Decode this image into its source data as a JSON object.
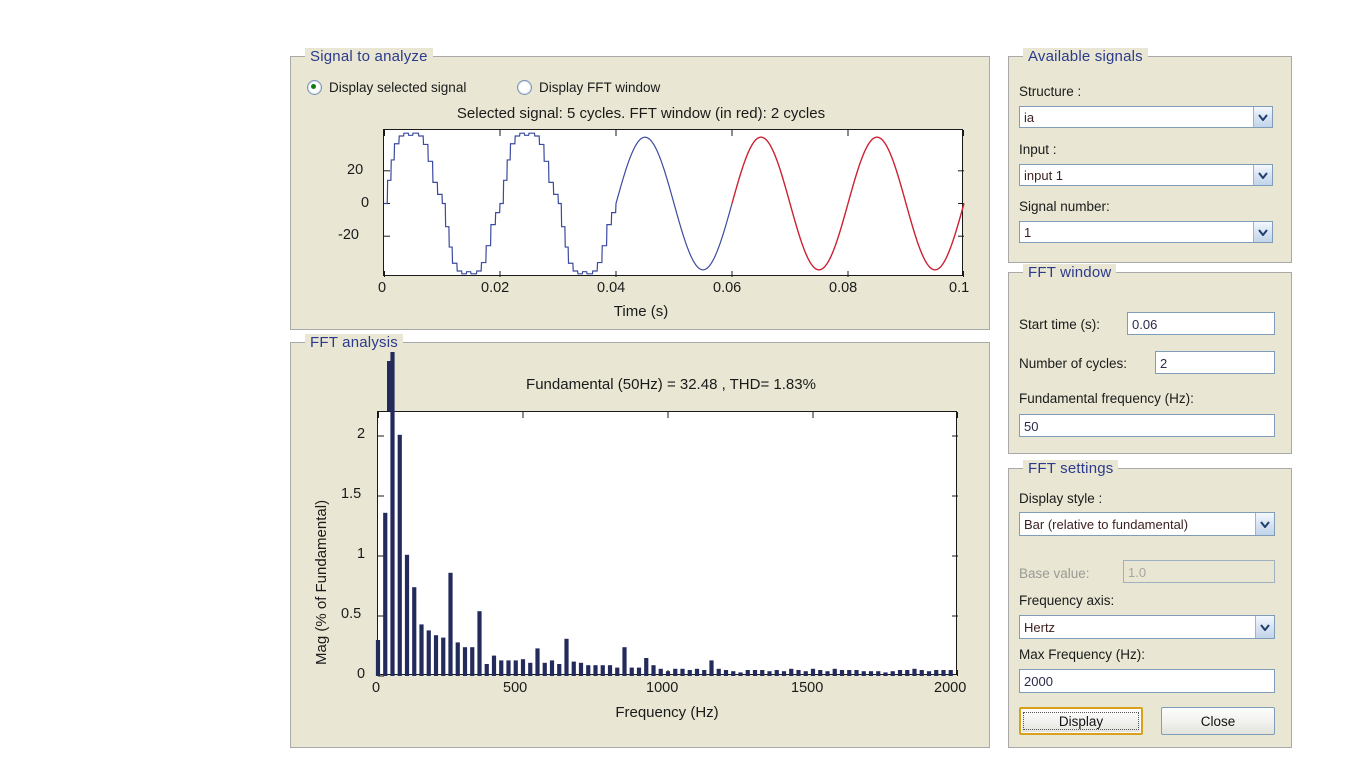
{
  "signal_panel": {
    "title": "Signal to analyze",
    "radios": [
      {
        "label": "Display selected signal",
        "checked": true
      },
      {
        "label": "Display FFT window",
        "checked": false
      }
    ]
  },
  "fft_analysis_panel": {
    "title": "FFT analysis"
  },
  "available_signals": {
    "title": "Available signals",
    "structure_label": "Structure :",
    "structure_value": "ia",
    "input_label": "Input :",
    "input_value": "input 1",
    "signal_number_label": "Signal number:",
    "signal_number_value": "1"
  },
  "fft_window": {
    "title": "FFT window",
    "start_time_label": "Start time (s):",
    "start_time_value": "0.06",
    "cycles_label": "Number of cycles:",
    "cycles_value": "2",
    "fundamental_label": "Fundamental frequency (Hz):",
    "fundamental_value": "50"
  },
  "fft_settings": {
    "title": "FFT settings",
    "display_style_label": "Display style :",
    "display_style_value": "Bar (relative to fundamental)",
    "base_value_label": "Base value:",
    "base_value_value": "1.0",
    "frequency_axis_label": "Frequency axis:",
    "frequency_axis_value": "Hertz",
    "max_frequency_label": "Max Frequency (Hz):",
    "max_frequency_value": "2000",
    "display_button": "Display",
    "close_button": "Close"
  },
  "colors": {
    "panel_bg": "#e9e7d3",
    "panel_title": "#2b3a8c",
    "signal_blue": "#3b4a9e",
    "signal_red": "#cc2233",
    "bar_navy": "#232a5c",
    "focus_gold": "#d7a11e"
  },
  "chart_data": [
    {
      "type": "line",
      "name": "selected-signal",
      "title": "Selected signal: 5 cycles. FFT window (in red): 2 cycles",
      "xlabel": "Time (s)",
      "ylabel": "",
      "xlim": [
        0,
        0.1
      ],
      "ylim": [
        -36,
        36
      ],
      "xticks": [
        0,
        0.02,
        0.04,
        0.06,
        0.08,
        0.1
      ],
      "xticklabels": [
        "0",
        "0.02",
        "0.04",
        "0.06",
        "0.08",
        "0.1"
      ],
      "yticks": [
        -20,
        0,
        20
      ],
      "yticklabels": [
        "-20",
        "0",
        "20"
      ],
      "grid": false,
      "fft_window_start": 0.06,
      "fft_window_end": 0.1,
      "series": [
        {
          "name": "stepped-quasi-square-portion",
          "color": "#3b4a9e",
          "description": "stepped multilevel inverter output, 0 to 0.04 s, 2 cycles",
          "segment_color_split": 0.06
        },
        {
          "name": "sinusoidal-portion",
          "color": "#3b4a9e",
          "description": "smooth sine 50 Hz amplitude 32.5, 0.04 to 0.06 s blue"
        },
        {
          "name": "fft-window-portion",
          "color": "#cc2233",
          "description": "smooth sine 50 Hz amplitude 32.5, 0.06 to 0.1 s red"
        }
      ]
    },
    {
      "type": "bar",
      "name": "fft-spectrum",
      "title": "Fundamental (50Hz) = 32.48 , THD= 1.83%",
      "xlabel": "Frequency (Hz)",
      "ylabel": "Mag (% of Fundamental)",
      "xlim": [
        0,
        2000
      ],
      "ylim": [
        0,
        2.2
      ],
      "xticks": [
        0,
        500,
        1000,
        1500,
        2000
      ],
      "xticklabels": [
        "0",
        "500",
        "1000",
        "1500",
        "2000"
      ],
      "yticks": [
        0,
        0.5,
        1,
        1.5,
        2
      ],
      "yticklabels": [
        "0",
        "0.5",
        "1",
        "1.5",
        "2"
      ],
      "grid": false,
      "bar_color": "#232a5c",
      "bar_spacing_hz": 25,
      "fundamental_hz": 50,
      "fundamental_magnitude": 32.48,
      "thd_percent": 1.83,
      "x": [
        0,
        25,
        50,
        75,
        100,
        125,
        150,
        175,
        200,
        225,
        250,
        275,
        300,
        325,
        350,
        375,
        400,
        425,
        450,
        475,
        500,
        525,
        550,
        575,
        600,
        625,
        650,
        675,
        700,
        725,
        750,
        775,
        800,
        825,
        850,
        875,
        900,
        925,
        950,
        975,
        1000,
        1025,
        1050,
        1075,
        1100,
        1125,
        1150,
        1175,
        1200,
        1225,
        1250,
        1275,
        1300,
        1325,
        1350,
        1375,
        1400,
        1425,
        1450,
        1475,
        1500,
        1525,
        1550,
        1575,
        1600,
        1625,
        1650,
        1675,
        1700,
        1725,
        1750,
        1775,
        1800,
        1825,
        1850,
        1875,
        1900,
        1925,
        1950,
        1975
      ],
      "values": [
        0.3,
        1.36,
        100.0,
        2.01,
        1.01,
        0.74,
        0.43,
        0.38,
        0.34,
        0.32,
        0.86,
        0.28,
        0.24,
        0.24,
        0.54,
        0.1,
        0.17,
        0.13,
        0.13,
        0.13,
        0.14,
        0.11,
        0.23,
        0.11,
        0.13,
        0.1,
        0.31,
        0.12,
        0.11,
        0.09,
        0.09,
        0.09,
        0.09,
        0.07,
        0.24,
        0.07,
        0.07,
        0.15,
        0.09,
        0.06,
        0.04,
        0.06,
        0.06,
        0.05,
        0.06,
        0.05,
        0.13,
        0.06,
        0.05,
        0.04,
        0.03,
        0.05,
        0.05,
        0.05,
        0.04,
        0.05,
        0.04,
        0.06,
        0.05,
        0.04,
        0.06,
        0.05,
        0.04,
        0.06,
        0.05,
        0.05,
        0.05,
        0.04,
        0.04,
        0.04,
        0.03,
        0.04,
        0.05,
        0.05,
        0.06,
        0.05,
        0.04,
        0.05,
        0.05,
        0.05
      ],
      "note": "value at 50 Hz is the fundamental and is clipped by the axes top (drawn beyond ylim)"
    }
  ]
}
